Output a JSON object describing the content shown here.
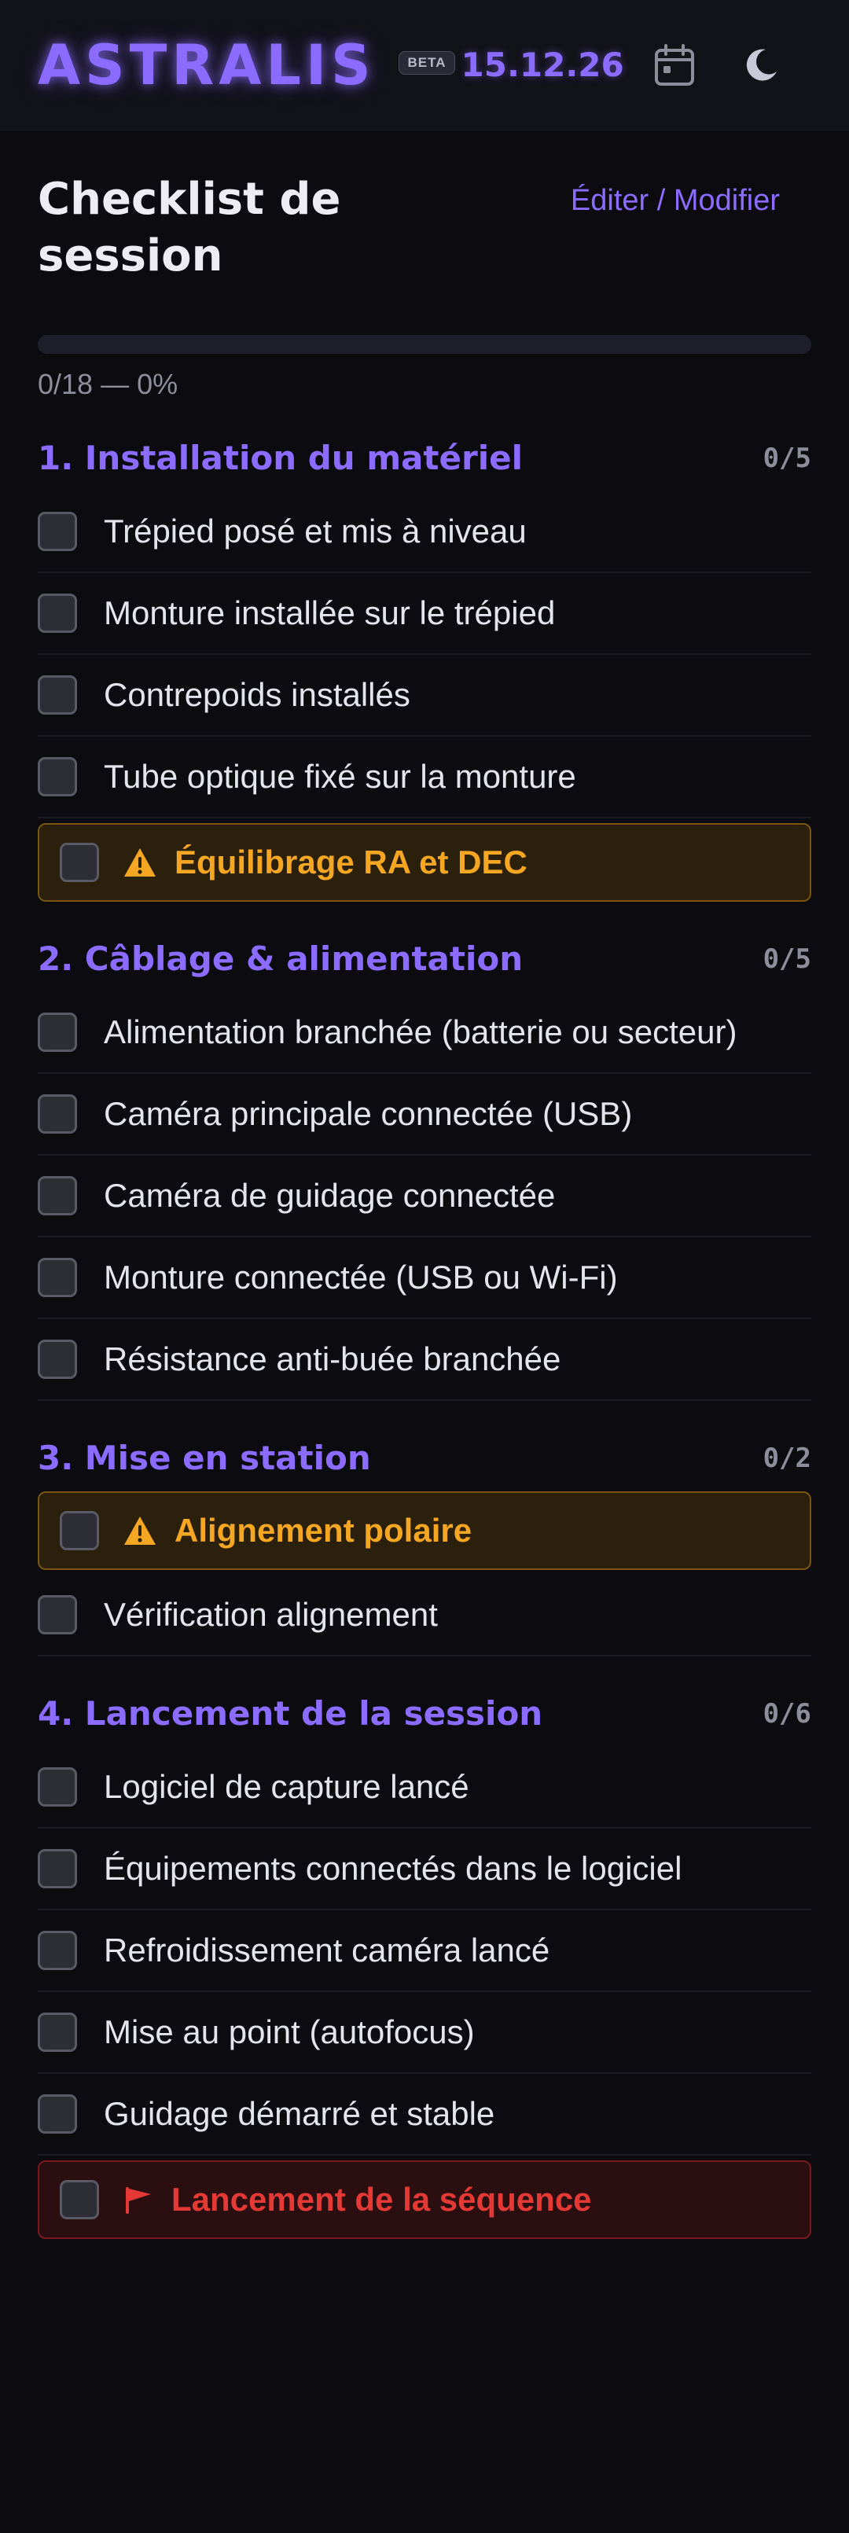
{
  "header": {
    "logo": "ASTRALIS",
    "badge": "BETA",
    "date": "15.12.26"
  },
  "page": {
    "title": "Checklist de session",
    "edit_label": "Éditer / Modifier",
    "progress": {
      "done": 0,
      "total": 18,
      "percent": 0,
      "text": "0/18 — 0%"
    }
  },
  "sections": [
    {
      "title": "1. Installation du matériel",
      "count": "0/5",
      "items": [
        {
          "label": "Trépied posé et mis à niveau"
        },
        {
          "label": "Monture installée sur le trépied"
        },
        {
          "label": "Contrepoids installés"
        },
        {
          "label": "Tube optique fixé sur la monture"
        },
        {
          "label": "Équilibrage RA et DEC",
          "critical": "warning"
        }
      ]
    },
    {
      "title": "2. Câblage & alimentation",
      "count": "0/5",
      "items": [
        {
          "label": "Alimentation branchée (batterie ou secteur)"
        },
        {
          "label": "Caméra principale connectée (USB)"
        },
        {
          "label": "Caméra de guidage connectée"
        },
        {
          "label": "Monture connectée (USB ou Wi-Fi)"
        },
        {
          "label": "Résistance anti-buée branchée"
        }
      ]
    },
    {
      "title": "3. Mise en station",
      "count": "0/2",
      "items": [
        {
          "label": "Alignement polaire",
          "critical": "warning"
        },
        {
          "label": "Vérification alignement"
        }
      ]
    },
    {
      "title": "4. Lancement de la session",
      "count": "0/6",
      "items": [
        {
          "label": "Logiciel de capture lancé"
        },
        {
          "label": "Équipements connectés dans le logiciel"
        },
        {
          "label": "Refroidissement caméra lancé"
        },
        {
          "label": "Mise au point (autofocus)"
        },
        {
          "label": "Guidage démarré et stable"
        },
        {
          "label": "Lancement de la séquence",
          "critical": "danger"
        }
      ]
    }
  ],
  "colors": {
    "accent": "#8b6cff",
    "warning": "#f5a623",
    "danger": "#e53935",
    "background": "#0b0b10"
  },
  "icons": {
    "calendar": "calendar-icon",
    "theme": "moon-icon",
    "warning": "warning-icon",
    "danger": "flag-icon"
  }
}
